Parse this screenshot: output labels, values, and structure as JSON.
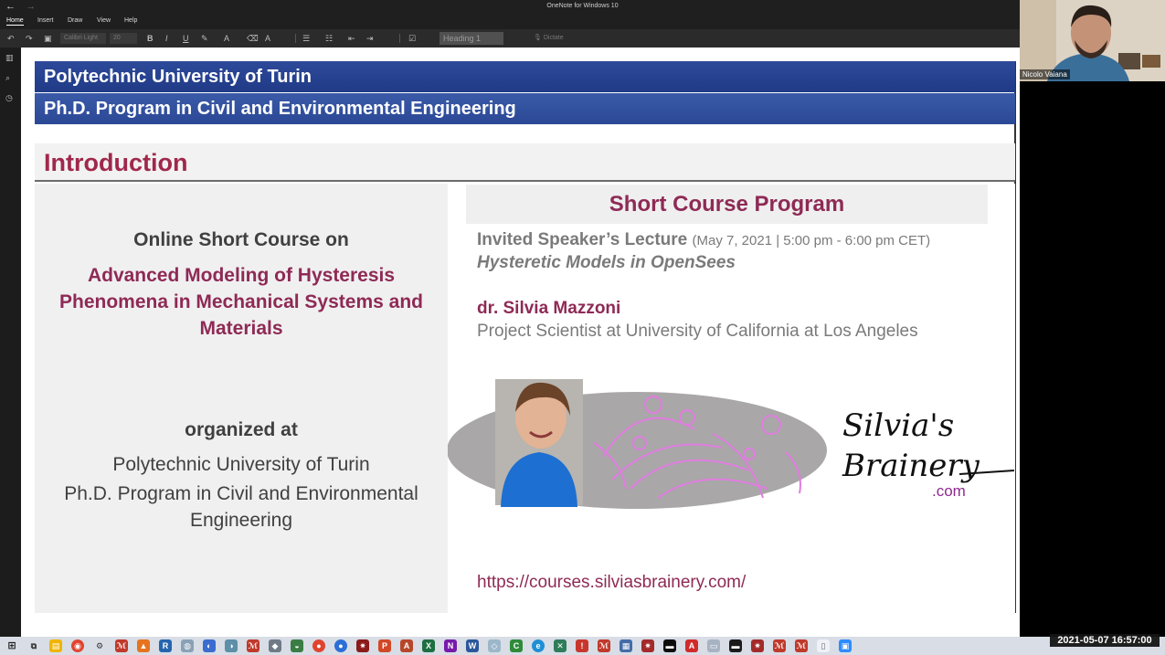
{
  "app": {
    "title": "OneNote for Windows 10",
    "nav_back": "←",
    "nav_forward": "→"
  },
  "ribbon": {
    "tabs": [
      "Home",
      "Insert",
      "Draw",
      "View",
      "Help"
    ],
    "active_tab": "Home",
    "font_name": "Calibri Light",
    "font_size": "20",
    "style": "Heading 1",
    "dictate": "Dictate"
  },
  "slide": {
    "header1": "Polytechnic University of Turin",
    "header2": "Ph.D. Program in Civil and Environmental Engineering",
    "section_title": "Introduction",
    "left": {
      "intro": "Online Short Course on",
      "course_lines": [
        "Advanced Modeling of Hysteresis",
        "Phenomena in Mechanical Systems and",
        "Materials"
      ],
      "organized": "organized at",
      "org_lines": [
        "Polytechnic University of Turin",
        "Ph.D. Program in Civil and Environmental",
        "Engineering"
      ]
    },
    "right": {
      "header": "Short Course Program",
      "lecture_label": "Invited Speaker’s Lecture",
      "lecture_when": "(May 7, 2021 | 5:00 pm - 6:00 pm CET)",
      "lecture_topic": "Hysteretic Models in OpenSees",
      "speaker": "dr. Silvia Mazzoni",
      "role": "Project Scientist at University of California at Los Angeles",
      "logo_text_1": "Silvia's",
      "logo_text_2": "Brainery",
      "logo_text_3": ".com",
      "url": "https://courses.silviasbrainery.com/"
    }
  },
  "webcam": {
    "name": "Nicolo Vaiana"
  },
  "timestamp": "2021-05-07  16:57:00",
  "colors": {
    "banner": "#2b4895",
    "accent": "#8e2a55",
    "text_gray": "#7a7a7a"
  }
}
